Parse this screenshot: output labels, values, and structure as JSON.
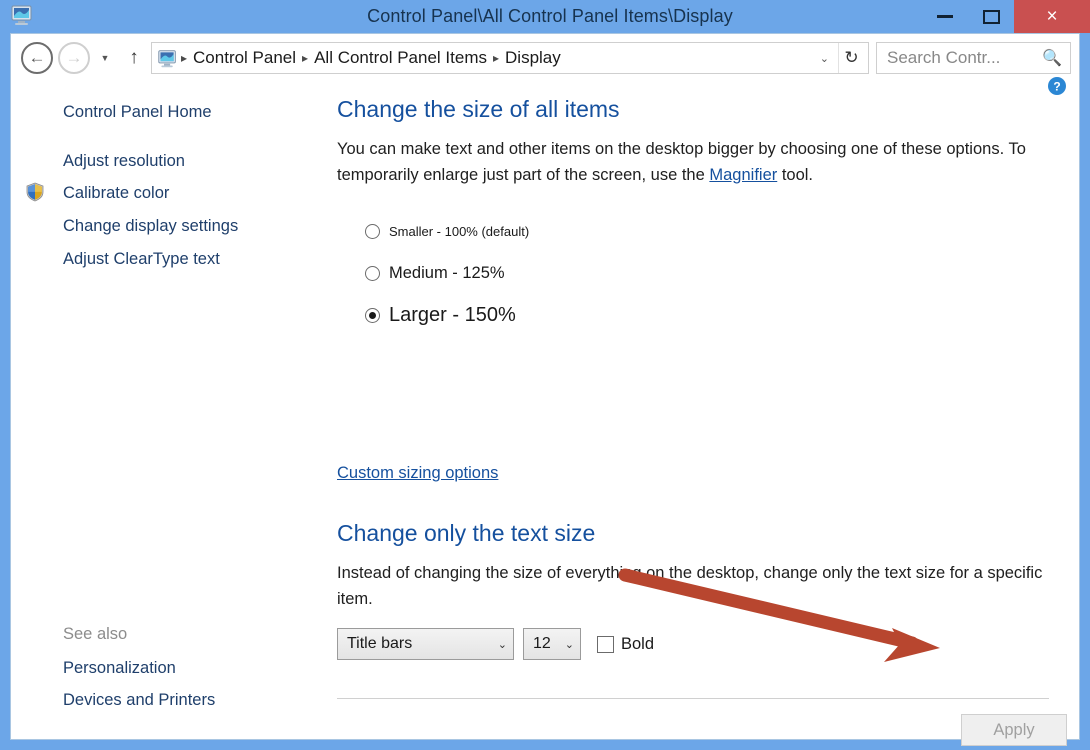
{
  "window": {
    "title": "Control Panel\\All Control Panel Items\\Display",
    "icon": "display-monitor-icon",
    "frame_color": "#6ca6e8",
    "close_color": "#c95050",
    "buttons": {
      "minimize": "minimize-button",
      "maximize": "maximize-button",
      "close": "×"
    }
  },
  "nav": {
    "back": "←",
    "forward": "→",
    "recent_dropdown": "▼",
    "up": "↑",
    "refresh": "↻",
    "breadcrumb_icon": "display-monitor-icon",
    "crumbs": [
      "Control Panel",
      "All Control Panel Items",
      "Display"
    ],
    "separator": "▸",
    "chevron": "⌄"
  },
  "search": {
    "placeholder": "Search Contr...",
    "value": "",
    "icon": "search-magnifier-icon"
  },
  "sidebar": {
    "home": "Control Panel Home",
    "items": [
      {
        "label": "Adjust resolution",
        "shield": false
      },
      {
        "label": "Calibrate color",
        "shield": true
      },
      {
        "label": "Change display settings",
        "shield": false
      },
      {
        "label": "Adjust ClearType text",
        "shield": false
      }
    ],
    "see_also_title": "See also",
    "see_also": [
      {
        "label": "Personalization"
      },
      {
        "label": "Devices and Printers"
      }
    ]
  },
  "content": {
    "help_icon": "?",
    "section1": {
      "heading": "Change the size of all items",
      "para_before": "You can make text and other items on the desktop bigger by choosing one of these options. To temporarily enlarge just part of the screen, use the ",
      "link": "Magnifier",
      "para_after": " tool."
    },
    "scale_options": [
      {
        "label": "Smaller - 100% (default)",
        "selected": false
      },
      {
        "label": "Medium - 125%",
        "selected": false
      },
      {
        "label": "Larger - 150%",
        "selected": true
      }
    ],
    "custom_link": "Custom sizing options",
    "section2": {
      "heading": "Change only the text size",
      "para": "Instead of changing the size of everything on the desktop, change only the text size for a specific item."
    },
    "controls": {
      "item_value": "Title bars",
      "size_value": "12",
      "bold_label": "Bold",
      "bold_checked": false,
      "arrow_glyph": "⌄"
    },
    "apply_label": "Apply",
    "apply_enabled": false
  },
  "annotation": {
    "type": "arrow",
    "color": "#b8462f",
    "points_to": "apply-button"
  }
}
